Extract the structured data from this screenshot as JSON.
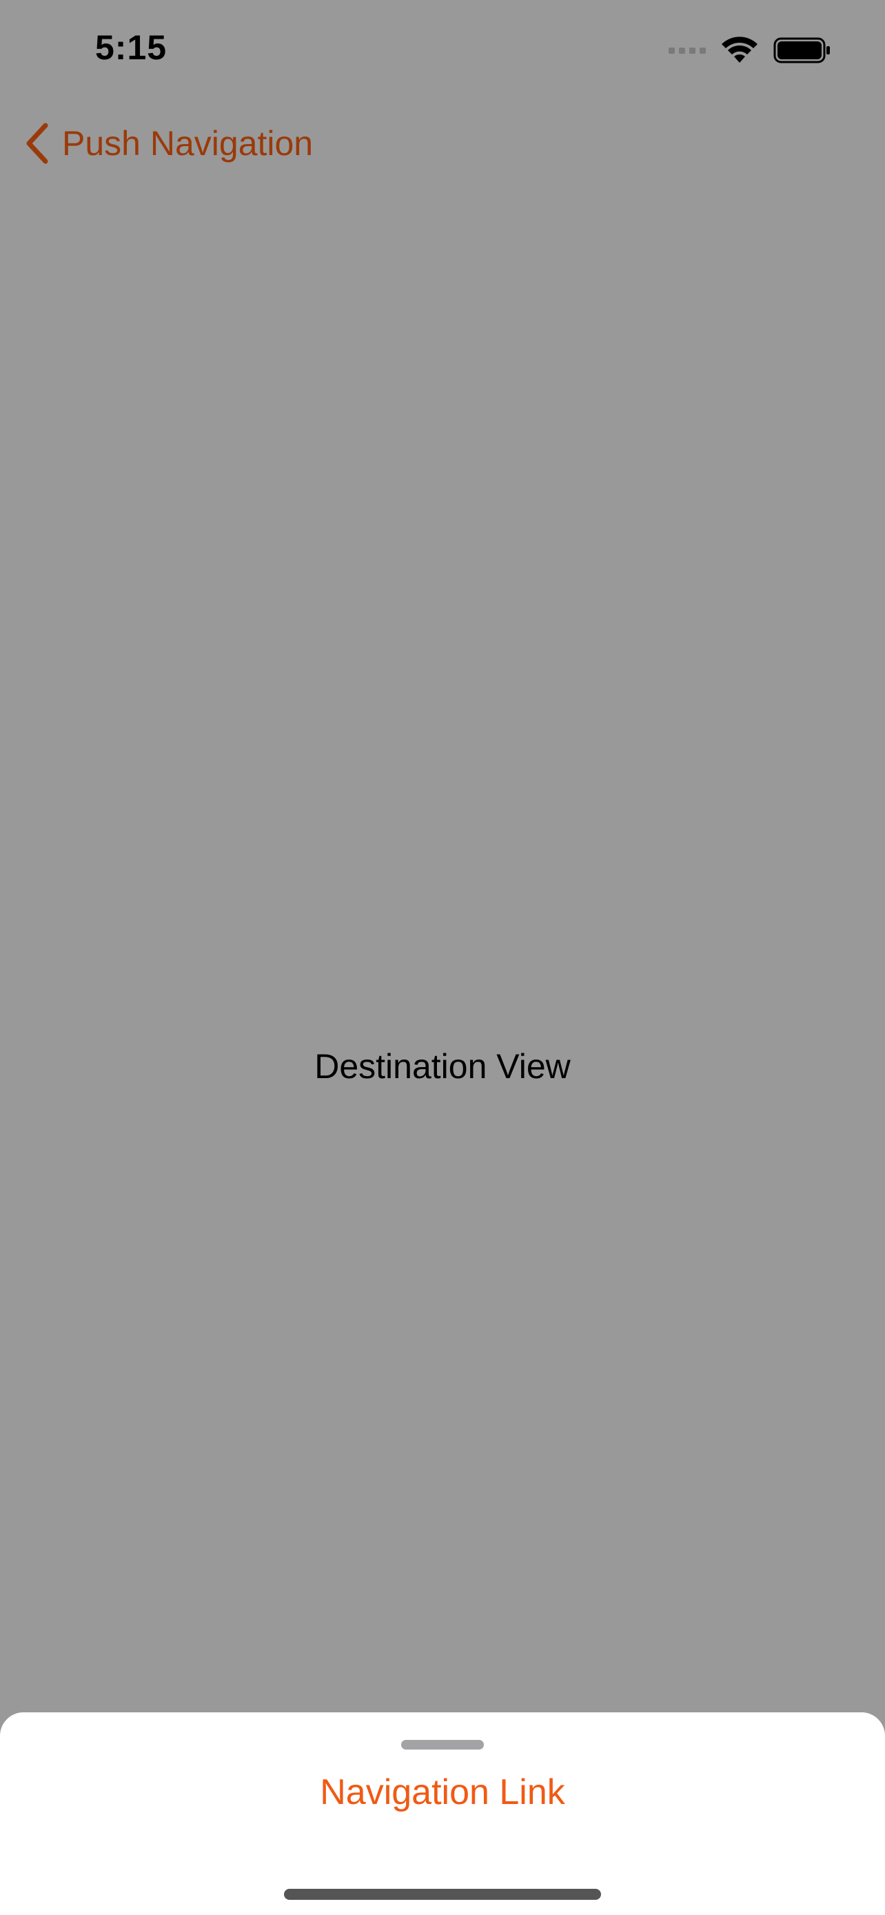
{
  "status_bar": {
    "time": "5:15",
    "icons": [
      "cellular-signal-icon",
      "wifi-icon",
      "battery-icon"
    ]
  },
  "nav": {
    "back_label": "Push Navigation",
    "accent_color": "#9a3a0a"
  },
  "content": {
    "title": "Destination View"
  },
  "sheet": {
    "link_label": "Navigation Link",
    "link_color": "#f05a14"
  }
}
